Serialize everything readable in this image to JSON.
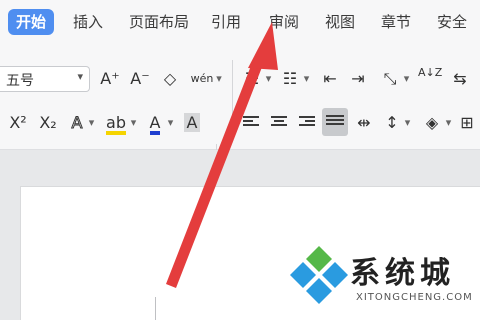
{
  "menu": {
    "items": [
      "开始",
      "插入",
      "页面布局",
      "引用",
      "审阅",
      "视图",
      "章节",
      "安全"
    ],
    "active_color": "#4f8ef0"
  },
  "ribbon": {
    "font_size": "五号",
    "superscript": "X²",
    "subscript": "X₂",
    "text_effect": "A",
    "highlight": "ab",
    "font_color": "A",
    "char_shading": "A",
    "grow_font": "A⁺",
    "shrink_font": "A⁻",
    "clear_format": "◇",
    "phonetic": "wén",
    "sort": "A↓Z",
    "highlight_color": "#f5d400",
    "font_color_value": "#1f3fd0"
  },
  "annotation": {
    "arrow_color": "#e43d3d"
  },
  "watermark": {
    "name": "系统城",
    "url": "XITONGCHENG.COM",
    "logo_colors": [
      "#55b848",
      "#2a9be0"
    ]
  }
}
